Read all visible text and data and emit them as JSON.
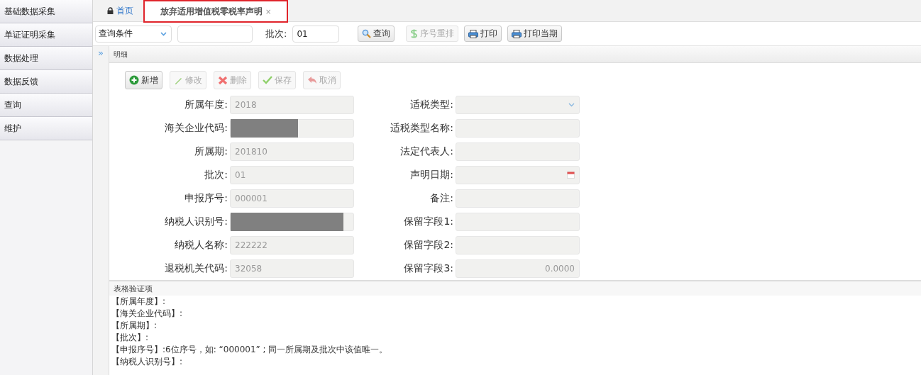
{
  "sidebar": {
    "items": [
      {
        "label": "基础数据采集",
        "selected": false
      },
      {
        "label": "单证证明采集",
        "selected": false
      },
      {
        "label": "数据处理",
        "selected": false
      },
      {
        "label": "数据反馈",
        "selected": false
      },
      {
        "label": "查询",
        "selected": false
      },
      {
        "label": "维护",
        "selected": false
      }
    ]
  },
  "tabs": [
    {
      "label": "首页",
      "kind": "home",
      "selected": false,
      "highlighted": false
    },
    {
      "label": "放弃适用增值税零税率声明",
      "kind": "page",
      "selected": true,
      "highlighted": true,
      "close_glyph": "×"
    }
  ],
  "toolbar": {
    "condition": {
      "value": "查询条件"
    },
    "batch_label": "批次:",
    "batch": {
      "value": "01"
    },
    "buttons": [
      {
        "label": "查询",
        "disabled": false
      },
      {
        "label": "序号重排",
        "disabled": true
      },
      {
        "label": "打印",
        "disabled": false
      },
      {
        "label": "打印当期",
        "disabled": false
      }
    ]
  },
  "panel": {
    "collapse_glyph": "»",
    "title": "明细",
    "actions": [
      {
        "label": "新增",
        "disabled": false
      },
      {
        "label": "修改",
        "disabled": true
      },
      {
        "label": "删除",
        "disabled": true
      },
      {
        "label": "保存",
        "disabled": true
      },
      {
        "label": "取消",
        "disabled": true
      }
    ],
    "left_fields": [
      {
        "label": "所属年度:",
        "value": "2018",
        "kind": "text"
      },
      {
        "label": "海关企业代码:",
        "kind": "redacted"
      },
      {
        "label": "所属期:",
        "value": "201810",
        "kind": "text"
      },
      {
        "label": "批次:",
        "value": "01",
        "kind": "text"
      },
      {
        "label": "申报序号:",
        "value": "000001",
        "kind": "text"
      },
      {
        "label": "纳税人识别号:",
        "kind": "redacted"
      },
      {
        "label": "纳税人名称:",
        "value": "222222",
        "kind": "text"
      },
      {
        "label": "退税机关代码:",
        "value": "32058",
        "kind": "text"
      }
    ],
    "right_fields": [
      {
        "label": "适税类型:",
        "kind": "select"
      },
      {
        "label": "适税类型名称:",
        "kind": "text"
      },
      {
        "label": "法定代表人:",
        "kind": "text"
      },
      {
        "label": "声明日期:",
        "kind": "date"
      },
      {
        "label": "备注:",
        "kind": "text"
      },
      {
        "label": "保留字段1:",
        "kind": "text"
      },
      {
        "label": "保留字段2:",
        "kind": "text"
      },
      {
        "label": "保留字段3:",
        "value": "0.0000",
        "kind": "number"
      }
    ]
  },
  "validation": {
    "title": "表格验证项",
    "lines": [
      "【所属年度】:",
      "【海关企业代码】:",
      "【所属期】:",
      "【批次】:",
      "【申报序号】:6位序号，如: “000001” ; 同一所属期及批次中该值唯一。",
      "【纳税人识别号】:"
    ]
  }
}
